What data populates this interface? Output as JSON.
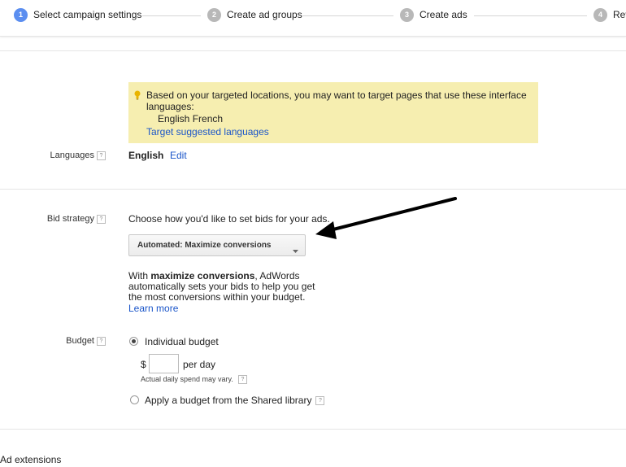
{
  "steps": [
    {
      "number": "1",
      "label": "Select campaign settings"
    },
    {
      "number": "2",
      "label": "Create ad groups"
    },
    {
      "number": "3",
      "label": "Create ads"
    },
    {
      "number": "4",
      "label": "Rev"
    }
  ],
  "languages": {
    "suggestion_text": "Based on your targeted locations, you may want to target pages that use these interface languages:",
    "suggested_languages": "English French",
    "target_link": "Target suggested languages",
    "label": "Languages",
    "help": "?",
    "value": "English",
    "edit_link": "Edit"
  },
  "bid_strategy": {
    "label": "Bid strategy",
    "help": "?",
    "prompt": "Choose how you'd like to set bids for your ads.",
    "selected": "Automated: Maximize conversions",
    "desc_prefix": "With ",
    "desc_bold": "maximize conversions",
    "desc_rest": ", AdWords automatically sets your bids to help you get the most conversions within your budget.",
    "learn_more": "Learn more"
  },
  "budget": {
    "label": "Budget",
    "help": "?",
    "option_individual": "Individual budget",
    "currency": "$",
    "amount": "",
    "per_day": "per day",
    "note": "Actual daily spend may vary.",
    "note_help": "?",
    "option_shared": "Apply a budget from the Shared library",
    "shared_help": "?"
  },
  "ad_extensions": {
    "label": "Ad extensions"
  },
  "colors": {
    "active_step": "#5b8ef0",
    "inactive_step": "#b8b8b8",
    "tip_bg": "#f6eeb0",
    "link": "#1a55c9",
    "bulb": "#e9b400"
  },
  "icons": [
    "lightbulb-icon",
    "dropdown-caret-icon",
    "annotation-arrow"
  ]
}
